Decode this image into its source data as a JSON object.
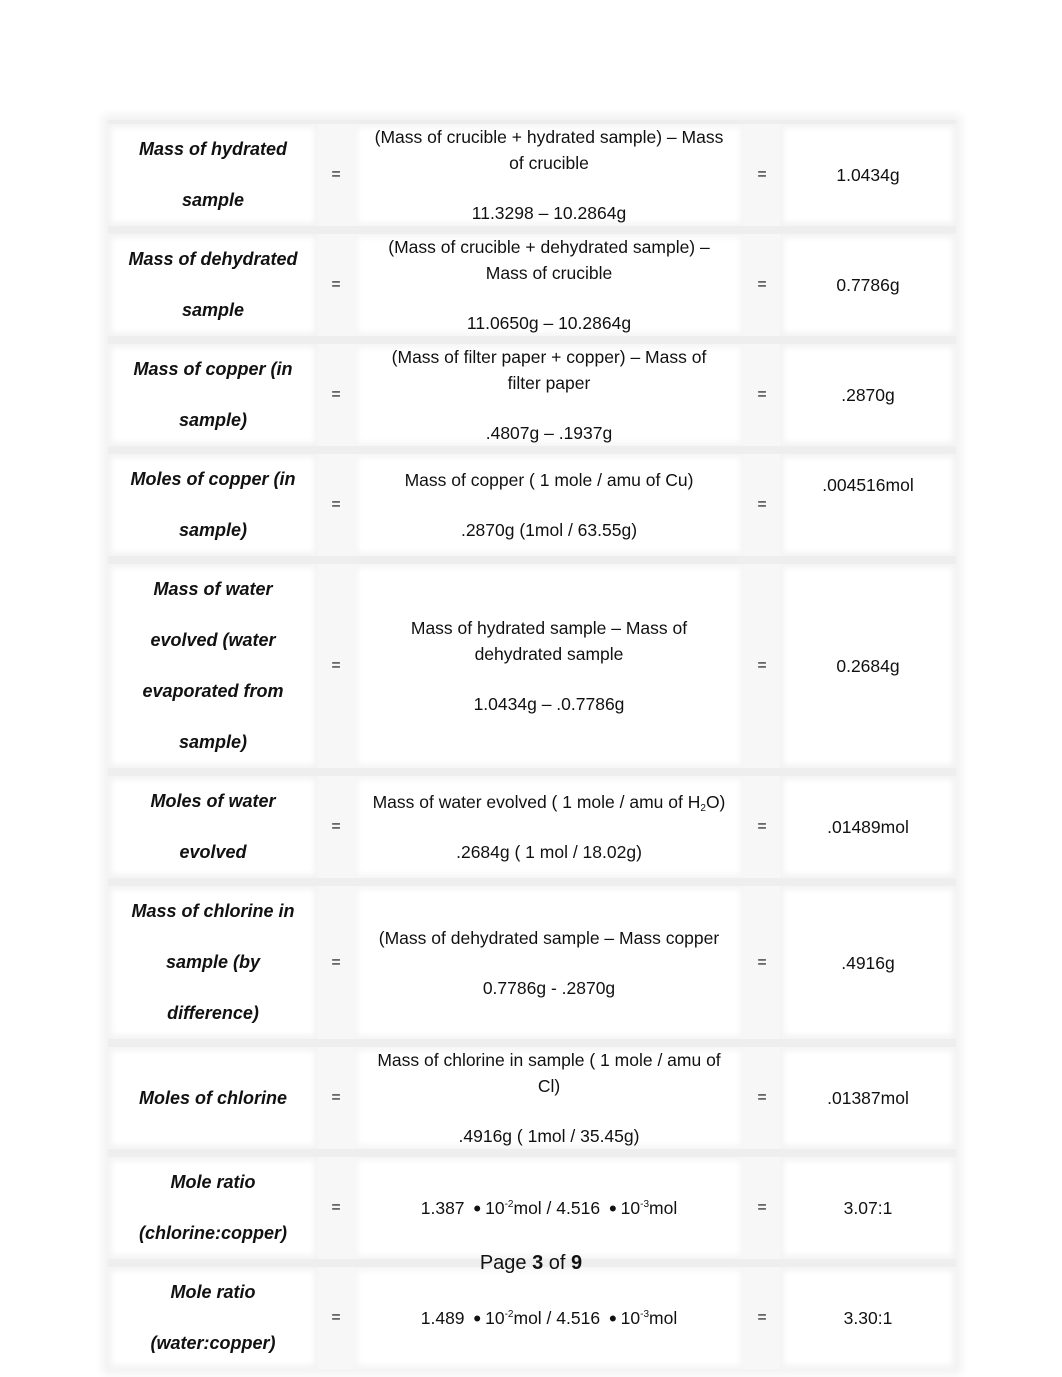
{
  "rows": [
    {
      "label_lines": [
        "Mass of hydrated",
        "sample"
      ],
      "eq": "=",
      "expr_line1": "(Mass of crucible + hydrated sample) – Mass of crucible",
      "expr_line2": "11.3298 – 10.2864g",
      "result": "1.0434g"
    },
    {
      "label_lines": [
        "Mass of dehydrated",
        "sample"
      ],
      "eq": "=",
      "expr_line1": "(Mass of crucible + dehydrated sample) – Mass of crucible",
      "expr_line2": "11.0650g – 10.2864g",
      "result": "0.7786g"
    },
    {
      "label_lines": [
        "Mass of copper (in",
        "sample)"
      ],
      "eq": "=",
      "expr_line1": "(Mass of filter paper + copper) – Mass of filter paper",
      "expr_line2": ".4807g – .1937g",
      "result": ".2870g"
    },
    {
      "label_lines": [
        "Moles of copper (in",
        "sample)"
      ],
      "eq": "=",
      "expr_line1": "Mass of copper ( 1 mole / amu of Cu)",
      "expr_line2": ".2870g (1mol / 63.55g)",
      "result": ".004516mol"
    },
    {
      "label_lines": [
        "Mass of water",
        "evolved (water",
        "evaporated from",
        "sample)"
      ],
      "eq": "=",
      "expr_line1": "Mass of hydrated sample – Mass of dehydrated sample",
      "expr_line2": "1.0434g – .0.7786g",
      "result": "0.2684g"
    },
    {
      "label_lines": [
        "Moles of water",
        "evolved"
      ],
      "eq": "=",
      "expr_line1_pre": "Mass of water evolved ( 1 mole / amu of H",
      "expr_line1_sub": "2",
      "expr_line1_post": "O)",
      "expr_line2": ".2684g ( 1 mol / 18.02g)",
      "result": ".01489mol"
    },
    {
      "label_lines": [
        "Mass of chlorine in",
        "sample (by",
        "difference)"
      ],
      "eq": "=",
      "expr_line1": "(Mass of dehydrated sample – Mass copper",
      "expr_line2": "0.7786g - .2870g",
      "result": ".4916g"
    },
    {
      "label_lines": [
        "Moles of chlorine"
      ],
      "eq": "=",
      "expr_line1": "Mass of chlorine in sample ( 1 mole / amu of Cl)",
      "expr_line2": ".4916g ( 1mol / 35.45g)",
      "result": ".01387mol"
    },
    {
      "label_lines": [
        "Mole ratio",
        "(chlorine:copper)"
      ],
      "eq": "=",
      "sci": {
        "a": "1.387",
        "dot": "•",
        "base1": "10",
        "exp1": "-2",
        "unit1": "mol / ",
        "b": "4.516",
        "base2": "10",
        "exp2": "-3",
        "unit2": "mol"
      },
      "result": "3.07:1"
    },
    {
      "label_lines": [
        "Mole ratio",
        "(water:copper)"
      ],
      "eq": "=",
      "sci": {
        "a": "1.489",
        "dot": "•",
        "base1": "10",
        "exp1": "-2",
        "unit1": "mol / ",
        "b": "4.516",
        "base2": "10",
        "exp2": "-3",
        "unit2": "mol"
      },
      "result": "3.30:1"
    }
  ],
  "footer": {
    "prefix": "Page ",
    "current": "3",
    "middle": " of ",
    "total": "9"
  }
}
